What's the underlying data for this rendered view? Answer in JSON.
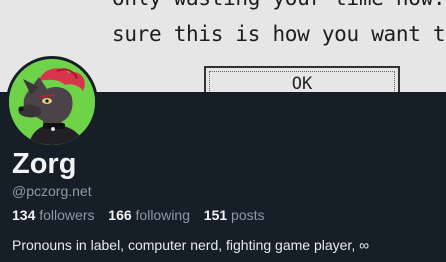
{
  "banner": {
    "line1": "only wasting your time now. A",
    "line2": "sure this is how you want to liv",
    "ok_label": "OK"
  },
  "profile": {
    "display_name": "Zorg",
    "handle": "@pczorg.net",
    "followers_count": "134",
    "followers_label": "followers",
    "following_count": "166",
    "following_label": "following",
    "posts_count": "151",
    "posts_label": "posts",
    "bio": "Pronouns in label, computer nerd, fighting game player, ∞"
  },
  "colors": {
    "background": "#161e27",
    "avatar_bg": "#6fd34a",
    "text_primary": "#f1f3f5",
    "text_secondary": "#8d9aa7"
  }
}
